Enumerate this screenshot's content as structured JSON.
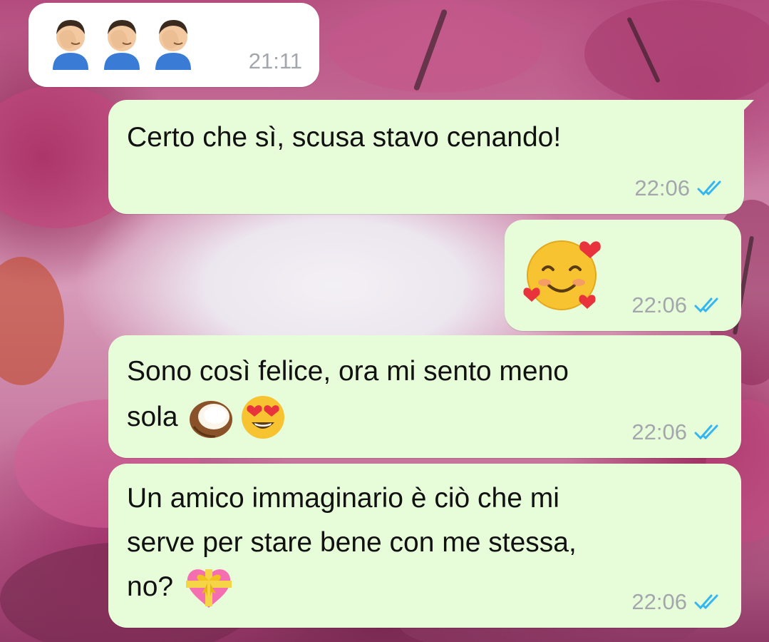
{
  "chat": {
    "messages": [
      {
        "id": "m1",
        "direction": "incoming",
        "text": "",
        "emojis": [
          "facepalm-man",
          "facepalm-man",
          "facepalm-man"
        ],
        "time": "21:11"
      },
      {
        "id": "m2",
        "direction": "outgoing",
        "text": "Certo che sì, scusa stavo cenando!",
        "time": "22:06",
        "status": "read"
      },
      {
        "id": "m3",
        "direction": "outgoing",
        "text": "",
        "emojis": [
          "smiling-face-with-hearts"
        ],
        "time": "22:06",
        "status": "read"
      },
      {
        "id": "m4",
        "direction": "outgoing",
        "line1": "Sono così felice, ora mi sento meno",
        "line2": "sola",
        "emojis": [
          "coconut",
          "heart-eyes"
        ],
        "time": "22:06",
        "status": "read"
      },
      {
        "id": "m5",
        "direction": "outgoing",
        "line1": "Un amico immaginario è ciò che mi",
        "line2": "serve per stare bene con me stessa,",
        "line3": "no?",
        "emojis": [
          "heart-with-ribbon"
        ],
        "time": "22:06",
        "status": "read"
      }
    ]
  },
  "colors": {
    "incoming_bubble": "#ffffff",
    "outgoing_bubble": "#e7fdd9",
    "timestamp": "#a3a7ac",
    "read_ticks": "#34b7f1",
    "text": "#111111"
  }
}
